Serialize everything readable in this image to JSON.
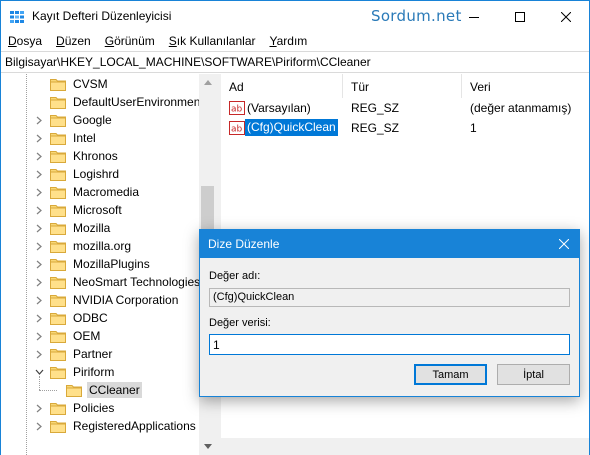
{
  "window": {
    "title": "Kayıt Defteri Düzenleyicisi",
    "watermark": "Sordum.net",
    "accent": "#1883d7"
  },
  "menu": [
    {
      "label": "Dosya",
      "u": "D",
      "rest": "osya"
    },
    {
      "label": "Düzen",
      "u": "D",
      "rest": "üzen"
    },
    {
      "label": "Görünüm",
      "u": "G",
      "rest": "örünüm"
    },
    {
      "label": "Sık Kullanılanlar",
      "u": "S",
      "rest": "ık Kullanılanlar"
    },
    {
      "label": "Yardım",
      "u": "Y",
      "rest": "ardım"
    }
  ],
  "address": "Bilgisayar\\HKEY_LOCAL_MACHINE\\SOFTWARE\\Piriform\\CCleaner",
  "tree": {
    "items": [
      {
        "label": "CVSM",
        "expand": "none"
      },
      {
        "label": "DefaultUserEnvironment",
        "expand": "none"
      },
      {
        "label": "Google",
        "expand": "collapsed"
      },
      {
        "label": "Intel",
        "expand": "collapsed"
      },
      {
        "label": "Khronos",
        "expand": "collapsed"
      },
      {
        "label": "Logishrd",
        "expand": "collapsed"
      },
      {
        "label": "Macromedia",
        "expand": "collapsed"
      },
      {
        "label": "Microsoft",
        "expand": "collapsed"
      },
      {
        "label": "Mozilla",
        "expand": "collapsed"
      },
      {
        "label": "mozilla.org",
        "expand": "collapsed"
      },
      {
        "label": "MozillaPlugins",
        "expand": "collapsed"
      },
      {
        "label": "NeoSmart Technologies",
        "expand": "collapsed"
      },
      {
        "label": "NVIDIA Corporation",
        "expand": "collapsed"
      },
      {
        "label": "ODBC",
        "expand": "collapsed"
      },
      {
        "label": "OEM",
        "expand": "collapsed"
      },
      {
        "label": "Partner",
        "expand": "collapsed"
      },
      {
        "label": "Piriform",
        "expand": "expanded"
      },
      {
        "label": "CCleaner",
        "expand": "none",
        "child": true,
        "selected": true
      },
      {
        "label": "Policies",
        "expand": "collapsed"
      },
      {
        "label": "RegisteredApplications",
        "expand": "collapsed"
      }
    ]
  },
  "values": {
    "columns": {
      "name": "Ad",
      "type": "Tür",
      "data": "Veri"
    },
    "rows": [
      {
        "name": "(Varsayılan)",
        "type": "REG_SZ",
        "data": "(değer atanmamış)",
        "selected": false
      },
      {
        "name": "(Cfg)QuickClean",
        "type": "REG_SZ",
        "data": "1",
        "selected": true
      }
    ]
  },
  "dialog": {
    "title": "Dize Düzenle",
    "name_label": "Değer adı:",
    "name_value": "(Cfg)QuickClean",
    "data_label": "Değer verisi:",
    "data_value": "1",
    "ok_label": "Tamam",
    "cancel_label": "İptal"
  }
}
